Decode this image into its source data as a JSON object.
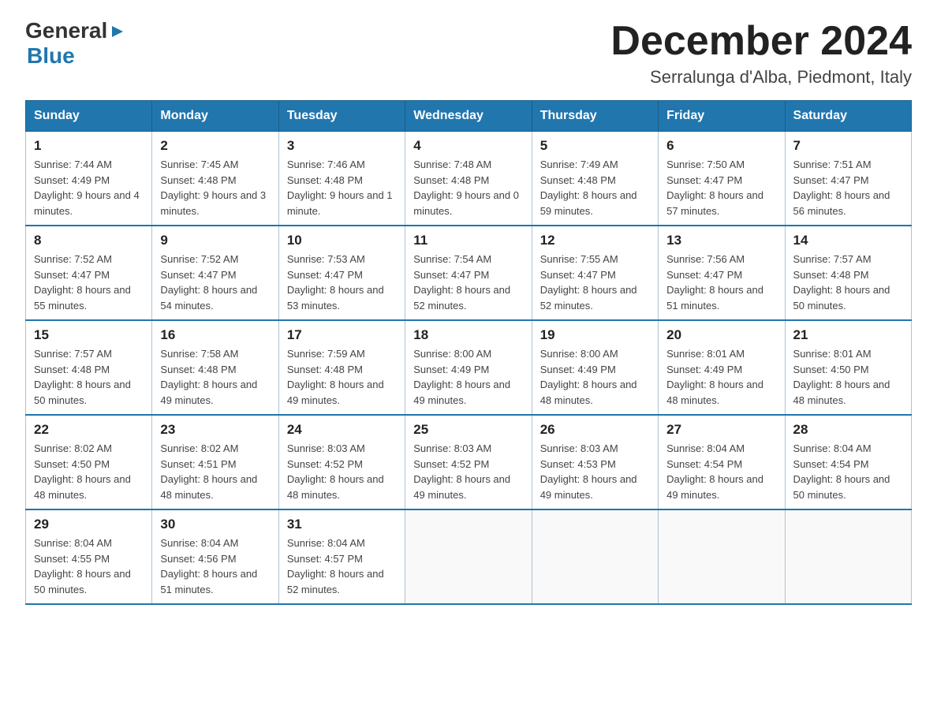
{
  "logo": {
    "line1": "General",
    "arrow": "▶",
    "line2": "Blue"
  },
  "header": {
    "month_title": "December 2024",
    "location": "Serralunga d'Alba, Piedmont, Italy"
  },
  "weekdays": [
    "Sunday",
    "Monday",
    "Tuesday",
    "Wednesday",
    "Thursday",
    "Friday",
    "Saturday"
  ],
  "weeks": [
    [
      {
        "day": "1",
        "sunrise": "7:44 AM",
        "sunset": "4:49 PM",
        "daylight": "9 hours and 4 minutes."
      },
      {
        "day": "2",
        "sunrise": "7:45 AM",
        "sunset": "4:48 PM",
        "daylight": "9 hours and 3 minutes."
      },
      {
        "day": "3",
        "sunrise": "7:46 AM",
        "sunset": "4:48 PM",
        "daylight": "9 hours and 1 minute."
      },
      {
        "day": "4",
        "sunrise": "7:48 AM",
        "sunset": "4:48 PM",
        "daylight": "9 hours and 0 minutes."
      },
      {
        "day": "5",
        "sunrise": "7:49 AM",
        "sunset": "4:48 PM",
        "daylight": "8 hours and 59 minutes."
      },
      {
        "day": "6",
        "sunrise": "7:50 AM",
        "sunset": "4:47 PM",
        "daylight": "8 hours and 57 minutes."
      },
      {
        "day": "7",
        "sunrise": "7:51 AM",
        "sunset": "4:47 PM",
        "daylight": "8 hours and 56 minutes."
      }
    ],
    [
      {
        "day": "8",
        "sunrise": "7:52 AM",
        "sunset": "4:47 PM",
        "daylight": "8 hours and 55 minutes."
      },
      {
        "day": "9",
        "sunrise": "7:52 AM",
        "sunset": "4:47 PM",
        "daylight": "8 hours and 54 minutes."
      },
      {
        "day": "10",
        "sunrise": "7:53 AM",
        "sunset": "4:47 PM",
        "daylight": "8 hours and 53 minutes."
      },
      {
        "day": "11",
        "sunrise": "7:54 AM",
        "sunset": "4:47 PM",
        "daylight": "8 hours and 52 minutes."
      },
      {
        "day": "12",
        "sunrise": "7:55 AM",
        "sunset": "4:47 PM",
        "daylight": "8 hours and 52 minutes."
      },
      {
        "day": "13",
        "sunrise": "7:56 AM",
        "sunset": "4:47 PM",
        "daylight": "8 hours and 51 minutes."
      },
      {
        "day": "14",
        "sunrise": "7:57 AM",
        "sunset": "4:48 PM",
        "daylight": "8 hours and 50 minutes."
      }
    ],
    [
      {
        "day": "15",
        "sunrise": "7:57 AM",
        "sunset": "4:48 PM",
        "daylight": "8 hours and 50 minutes."
      },
      {
        "day": "16",
        "sunrise": "7:58 AM",
        "sunset": "4:48 PM",
        "daylight": "8 hours and 49 minutes."
      },
      {
        "day": "17",
        "sunrise": "7:59 AM",
        "sunset": "4:48 PM",
        "daylight": "8 hours and 49 minutes."
      },
      {
        "day": "18",
        "sunrise": "8:00 AM",
        "sunset": "4:49 PM",
        "daylight": "8 hours and 49 minutes."
      },
      {
        "day": "19",
        "sunrise": "8:00 AM",
        "sunset": "4:49 PM",
        "daylight": "8 hours and 48 minutes."
      },
      {
        "day": "20",
        "sunrise": "8:01 AM",
        "sunset": "4:49 PM",
        "daylight": "8 hours and 48 minutes."
      },
      {
        "day": "21",
        "sunrise": "8:01 AM",
        "sunset": "4:50 PM",
        "daylight": "8 hours and 48 minutes."
      }
    ],
    [
      {
        "day": "22",
        "sunrise": "8:02 AM",
        "sunset": "4:50 PM",
        "daylight": "8 hours and 48 minutes."
      },
      {
        "day": "23",
        "sunrise": "8:02 AM",
        "sunset": "4:51 PM",
        "daylight": "8 hours and 48 minutes."
      },
      {
        "day": "24",
        "sunrise": "8:03 AM",
        "sunset": "4:52 PM",
        "daylight": "8 hours and 48 minutes."
      },
      {
        "day": "25",
        "sunrise": "8:03 AM",
        "sunset": "4:52 PM",
        "daylight": "8 hours and 49 minutes."
      },
      {
        "day": "26",
        "sunrise": "8:03 AM",
        "sunset": "4:53 PM",
        "daylight": "8 hours and 49 minutes."
      },
      {
        "day": "27",
        "sunrise": "8:04 AM",
        "sunset": "4:54 PM",
        "daylight": "8 hours and 49 minutes."
      },
      {
        "day": "28",
        "sunrise": "8:04 AM",
        "sunset": "4:54 PM",
        "daylight": "8 hours and 50 minutes."
      }
    ],
    [
      {
        "day": "29",
        "sunrise": "8:04 AM",
        "sunset": "4:55 PM",
        "daylight": "8 hours and 50 minutes."
      },
      {
        "day": "30",
        "sunrise": "8:04 AM",
        "sunset": "4:56 PM",
        "daylight": "8 hours and 51 minutes."
      },
      {
        "day": "31",
        "sunrise": "8:04 AM",
        "sunset": "4:57 PM",
        "daylight": "8 hours and 52 minutes."
      },
      null,
      null,
      null,
      null
    ]
  ]
}
